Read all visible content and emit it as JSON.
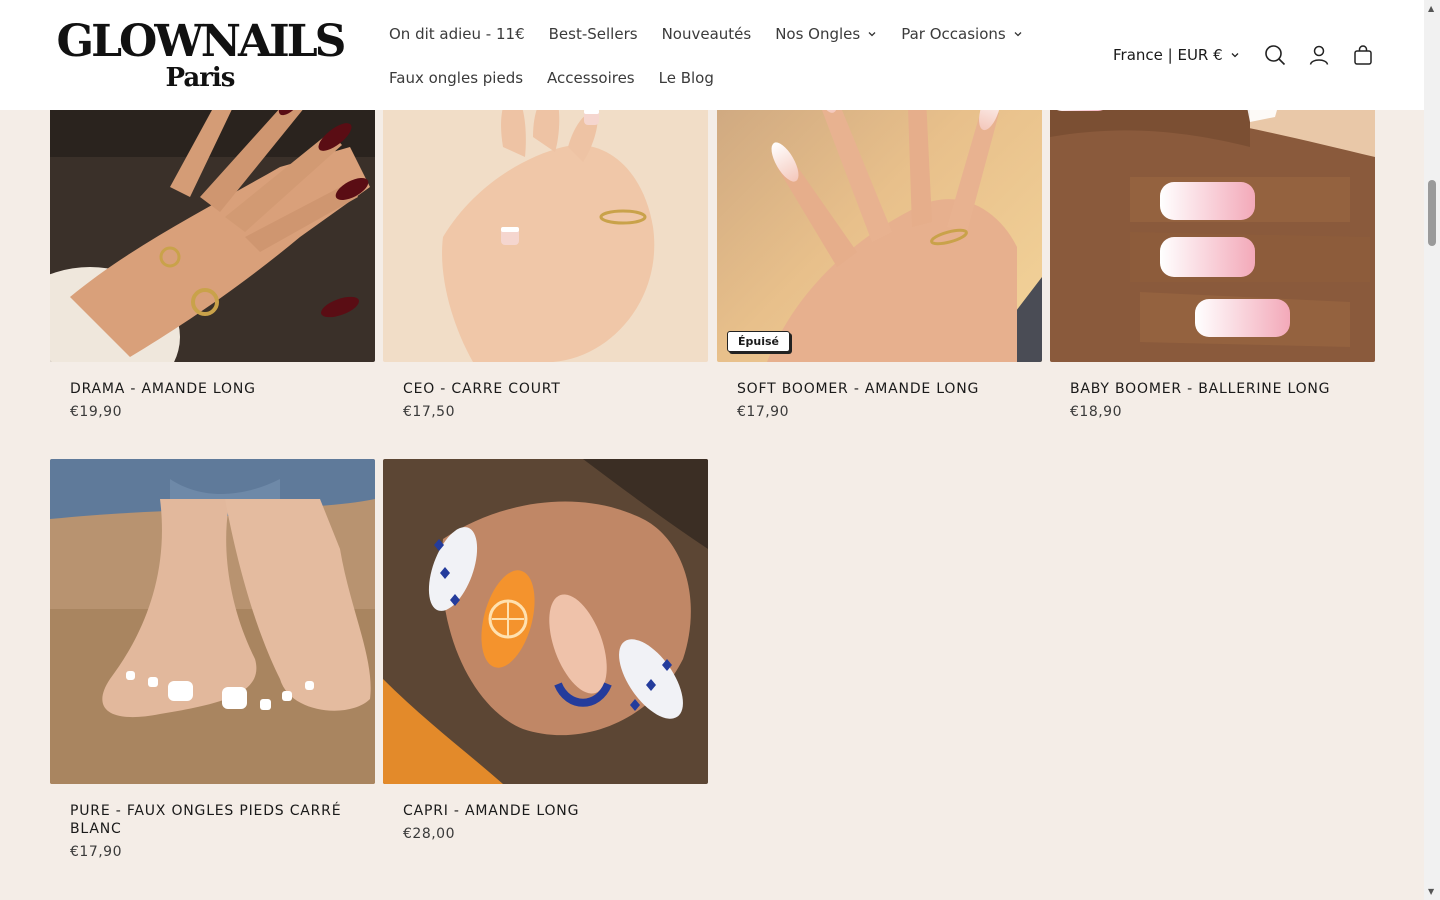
{
  "logo": {
    "main": "GLOWNAILS",
    "sub": "Paris"
  },
  "nav": {
    "row1": [
      {
        "label": "On dit adieu - 11€",
        "dropdown": false
      },
      {
        "label": "Best-Sellers",
        "dropdown": false
      },
      {
        "label": "Nouveautés",
        "dropdown": false
      },
      {
        "label": "Nos Ongles",
        "dropdown": true
      },
      {
        "label": "Par Occasions",
        "dropdown": true
      }
    ],
    "row2": [
      {
        "label": "Faux ongles pieds"
      },
      {
        "label": "Accessoires"
      },
      {
        "label": "Le Blog"
      }
    ]
  },
  "header": {
    "locale": "France | EUR €",
    "icons": [
      "search-icon",
      "account-icon",
      "cart-icon"
    ]
  },
  "products": [
    {
      "title": "DRAMA - AMANDE LONG",
      "price": "€19,90",
      "badge": ""
    },
    {
      "title": "CEO - CARRE COURT",
      "price": "€17,50",
      "badge": ""
    },
    {
      "title": "SOFT BOOMER - AMANDE LONG",
      "price": "€17,90",
      "badge": "Épuisé"
    },
    {
      "title": "BABY BOOMER - BALLERINE LONG",
      "price": "€18,90",
      "badge": ""
    },
    {
      "title": "PURE - FAUX ONGLES PIEDS CARRÉ BLANC",
      "price": "€17,90",
      "badge": ""
    },
    {
      "title": "CAPRI - AMANDE LONG",
      "price": "€28,00",
      "badge": ""
    }
  ],
  "colors": {
    "background": "#f4ede7",
    "header": "#ffffff",
    "text": "#1a1a1a"
  }
}
